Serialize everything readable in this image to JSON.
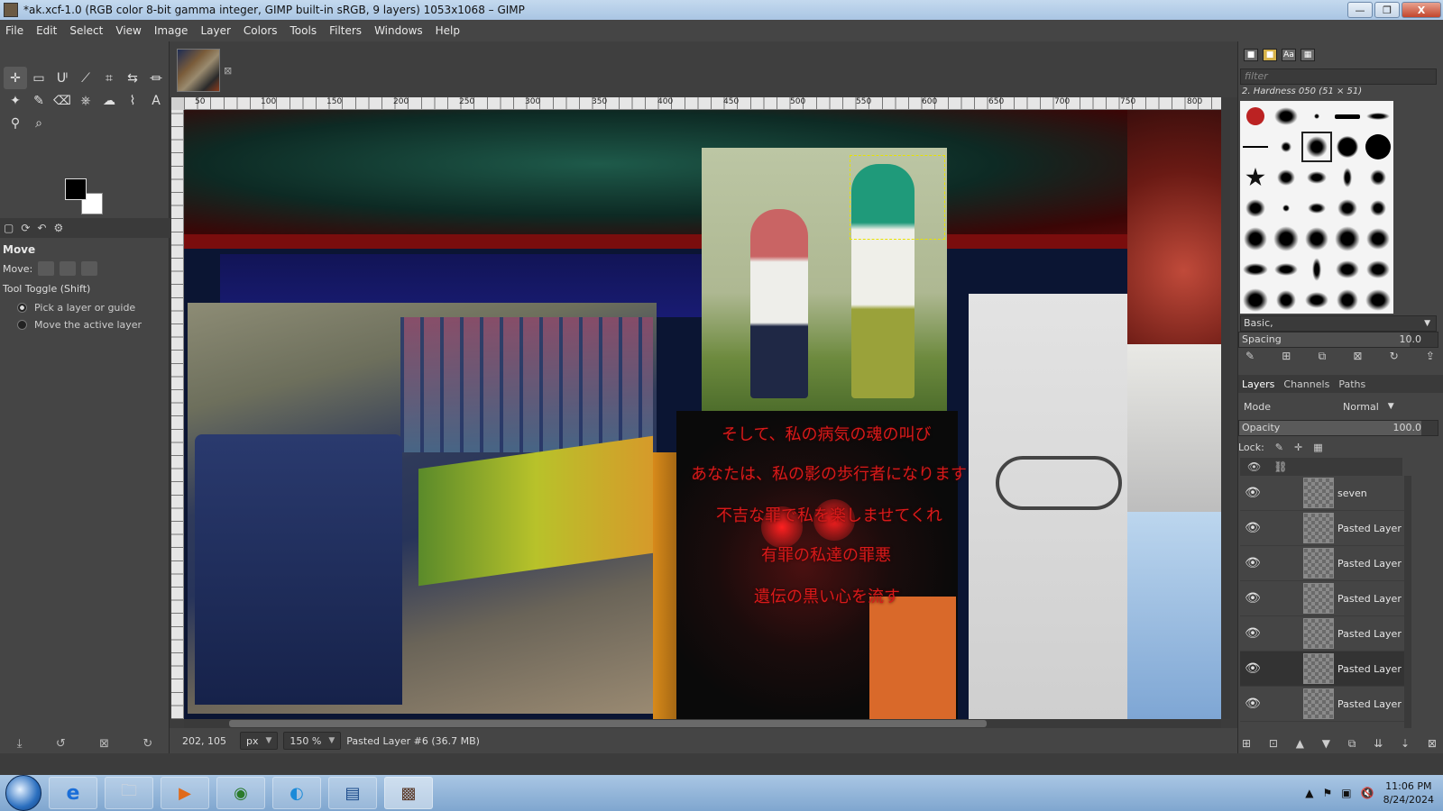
{
  "window": {
    "title": "*ak.xcf-1.0 (RGB color 8-bit gamma integer, GIMP built-in sRGB, 9 layers) 1053x1068 – GIMP",
    "minimize": "—",
    "maximize": "❐",
    "close": "X"
  },
  "menu": [
    "File",
    "Edit",
    "Select",
    "View",
    "Image",
    "Layer",
    "Colors",
    "Tools",
    "Filters",
    "Windows",
    "Help"
  ],
  "toolbox": {
    "tools": [
      "✛",
      "▭",
      "ᑧ",
      "⟋",
      "⌗",
      "⇆",
      "⏛",
      "✦",
      "✎",
      "⌫",
      "⎈",
      "☁",
      "⌇",
      "A",
      "⚲",
      "⌕"
    ],
    "dock_tab_icons": [
      "▢",
      "⟳",
      "↶",
      "⚙"
    ],
    "options": {
      "title": "Move",
      "move_label": "Move:",
      "toggle_label": "Tool Toggle  (Shift)",
      "radio1": "Pick a layer or guide",
      "radio2": "Move the active layer"
    },
    "bottom_icons": [
      "⤓",
      "↺",
      "⊠",
      "↻"
    ]
  },
  "image_tab": {
    "close": "⊠"
  },
  "ruler_labels": [
    "50",
    "100",
    "150",
    "200",
    "250",
    "300",
    "350",
    "400",
    "450",
    "500",
    "550",
    "600",
    "650",
    "700",
    "750",
    "800"
  ],
  "canvas": {
    "jp_lines": [
      "そして、私の病気の魂の叫び",
      "あなたは、私の影の歩行者になります",
      "不吉な罪で私を楽しませてくれ",
      "有罪の私達の罪悪",
      "遺伝の黒い心を流す"
    ]
  },
  "status": {
    "coords": "202, 105",
    "unit": "px",
    "zoom": "150 %",
    "layer_info": "Pasted Layer #6 (36.7 MB)"
  },
  "right_dock": {
    "top_icons": [
      "■",
      "■",
      "Aa",
      "▦"
    ],
    "filter_placeholder": "filter",
    "brush_name": "2. Hardness 050 (51 × 51)",
    "brush_preset": "Basic,",
    "spacing_label": "Spacing",
    "spacing_value": "10.0",
    "brush_actions": [
      "✎",
      "⊞",
      "⧉",
      "⊠",
      "↻",
      "⇪"
    ],
    "tabs": [
      "Layers",
      "Channels",
      "Paths"
    ],
    "mode_label": "Mode",
    "mode_value": "Normal",
    "opacity_label": "Opacity",
    "opacity_value": "100.0",
    "lock_label": "Lock:",
    "lock_icons": [
      "✎",
      "✛",
      "▦"
    ],
    "layers": [
      "seven",
      "Pasted Layer",
      "Pasted Layer",
      "Pasted Layer",
      "Pasted Layer",
      "Pasted Layer",
      "Pasted Layer"
    ],
    "active_layer_index": 5,
    "layer_actions": [
      "⊞",
      "⊡",
      "▲",
      "▼",
      "⧉",
      "⇊",
      "⇣",
      "⊠"
    ]
  },
  "taskbar": {
    "apps": [
      "e",
      "🗀",
      "▶",
      "◉",
      "◐",
      "▤",
      "▩"
    ],
    "time": "11:06 PM",
    "date": "8/24/2024",
    "tray_icons": [
      "▲",
      "⚑",
      "▣",
      "🔇"
    ]
  }
}
